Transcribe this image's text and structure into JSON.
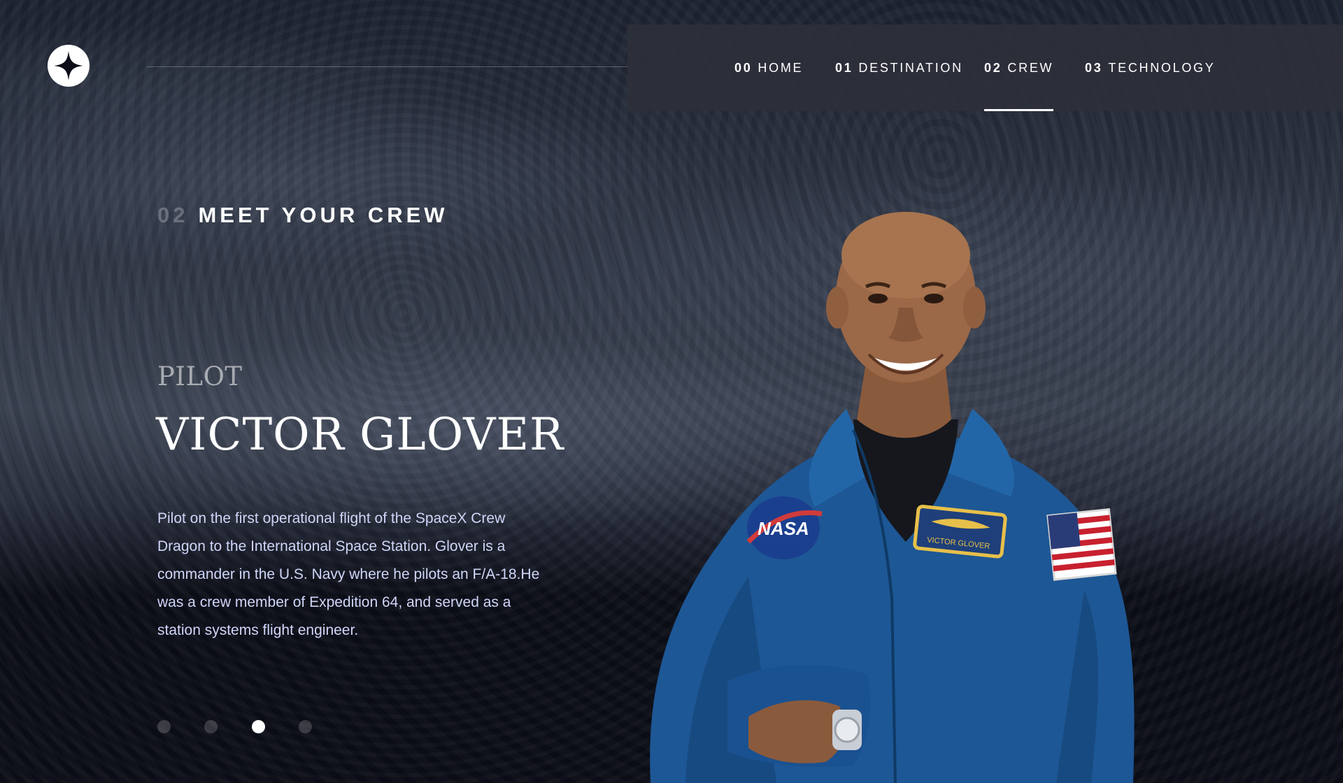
{
  "header": {
    "logo_icon": "star-logo-icon",
    "nav": [
      {
        "num": "00",
        "label": "HOME"
      },
      {
        "num": "01",
        "label": "DESTINATION"
      },
      {
        "num": "02",
        "label": "CREW"
      },
      {
        "num": "03",
        "label": "TECHNOLOGY"
      }
    ],
    "active_nav": "CREW"
  },
  "main": {
    "heading_num": "02",
    "heading_text": "MEET YOUR CREW",
    "role": "PILOT",
    "name": "VICTOR GLOVER",
    "bio": "Pilot on the first operational flight of the SpaceX Crew Dragon to the International Space Station. Glover is a commander in the U.S. Navy where he pilots an F/A-18.He was a crew member of Expedition 64, and served as a station systems flight engineer.",
    "carousel": {
      "count": 4,
      "active_index": 3
    }
  },
  "portrait": {
    "patch_nasa": "NASA",
    "patch_name": "VICTOR GLOVER"
  },
  "colors": {
    "background": "#0b0d17",
    "accent_text": "#d0d6f9",
    "nav_bg": "#2d303a",
    "suit_blue": "#1e5a98"
  }
}
